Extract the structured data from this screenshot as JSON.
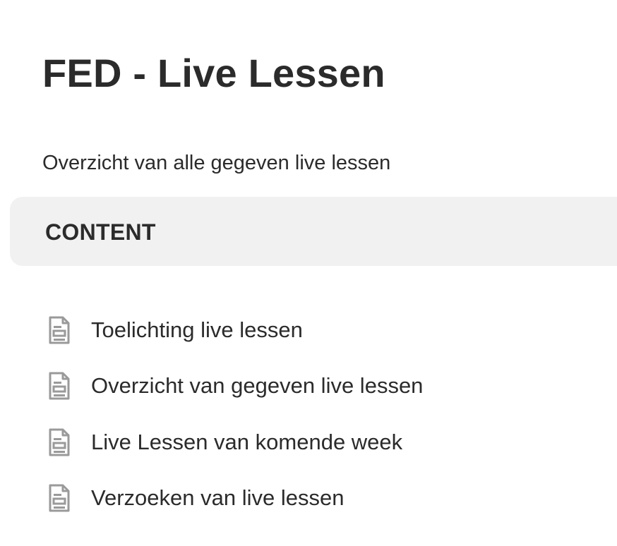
{
  "page": {
    "title": "FED - Live Lessen",
    "description": "Overzicht van alle gegeven live lessen"
  },
  "content_section": {
    "title": "CONTENT",
    "items": [
      {
        "label": "Toelichting live lessen",
        "icon": "document-icon"
      },
      {
        "label": "Overzicht van gegeven live lessen",
        "icon": "document-icon"
      },
      {
        "label": "Live Lessen van komende week",
        "icon": "document-icon"
      },
      {
        "label": "Verzoeken van live lessen",
        "icon": "document-icon"
      }
    ]
  },
  "colors": {
    "text": "#2b2b2b",
    "section_background": "#f1f1f1",
    "icon": "#9a9a9a"
  }
}
